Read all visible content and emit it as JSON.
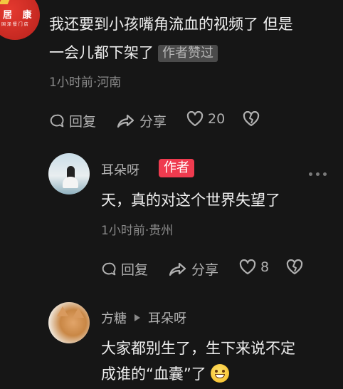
{
  "top_comment": {
    "avatar_brand": "居 康",
    "avatar_sub": "国 泽 餐 门 店",
    "line1": "我还要到小孩嘴角流血的视频了  但是",
    "line2": "一会儿都下架了",
    "author_liked_badge": "作者赞过",
    "meta": "1小时前·河南",
    "actions": {
      "reply": "回复",
      "share": "分享",
      "like_count": "20"
    }
  },
  "reply1": {
    "name": "耳朵呀",
    "author_badge": "作者",
    "text": "天，真的对这个世界失望了",
    "meta": "1小时前·贵州",
    "actions": {
      "reply": "回复",
      "share": "分享",
      "like_count": "8"
    }
  },
  "reply2": {
    "name": "方糖",
    "reply_to": "耳朵呀",
    "line1": "大家都别生了，生下来说不定",
    "line2": "成谁的“血囊”了",
    "emoji": "grinning-face-emoji"
  },
  "icons": [
    "reply-icon",
    "share-icon",
    "heart-icon",
    "broken-heart-icon",
    "more-dots-icon",
    "triangle-right-icon"
  ]
}
